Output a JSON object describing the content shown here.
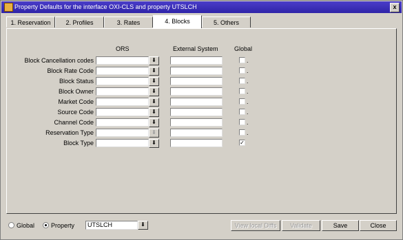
{
  "window": {
    "title": "Property Defaults for the interface OXI-CLS and property UTSLCH",
    "close_glyph": "x"
  },
  "tabs": [
    {
      "label": "1. Reservation"
    },
    {
      "label": "2. Profiles"
    },
    {
      "label": "3. Rates"
    },
    {
      "label": "4. Blocks",
      "active": true
    },
    {
      "label": "5. Others"
    }
  ],
  "columns": {
    "ors": "ORS",
    "external": "External System",
    "global": "Global"
  },
  "rows": [
    {
      "label": "Block Cancellation codes",
      "global_checked": false,
      "dropdown_enabled": true
    },
    {
      "label": "Block Rate Code",
      "global_checked": false,
      "dropdown_enabled": true
    },
    {
      "label": "Block Status",
      "global_checked": false,
      "dropdown_enabled": true
    },
    {
      "label": "Block Owner",
      "global_checked": false,
      "dropdown_enabled": true
    },
    {
      "label": "Market Code",
      "global_checked": false,
      "dropdown_enabled": true
    },
    {
      "label": "Source Code",
      "global_checked": false,
      "dropdown_enabled": true
    },
    {
      "label": "Channel Code",
      "global_checked": false,
      "dropdown_enabled": true
    },
    {
      "label": "Reservation Type",
      "global_checked": false,
      "dropdown_enabled": false
    },
    {
      "label": "Block Type",
      "global_checked": true,
      "dropdown_enabled": true
    }
  ],
  "dot": ".",
  "dropdown_glyph": "⬇",
  "check_glyph": "✓",
  "footer": {
    "radio_global": "Global",
    "radio_property": "Property",
    "property_value": "UTSLCH",
    "buttons": {
      "view_local_diffs": "View local Diffs",
      "validate": "Validate",
      "save": "Save",
      "close": "Close"
    }
  }
}
